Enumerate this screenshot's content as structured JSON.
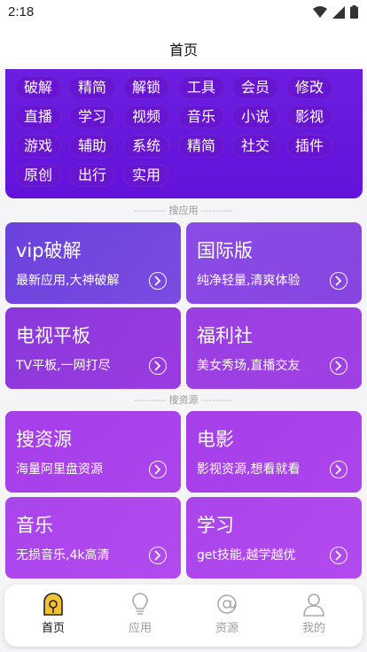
{
  "status_bar": {
    "time": "2:18",
    "icons": [
      "wifi-icon",
      "signal-icon",
      "battery-icon"
    ]
  },
  "header": {
    "title": "首页"
  },
  "tags": [
    "破解",
    "精简",
    "解锁",
    "工具",
    "会员",
    "修改",
    "直播",
    "学习",
    "视频",
    "音乐",
    "小说",
    "影视",
    "游戏",
    "辅助",
    "系统",
    "精简",
    "社交",
    "插件",
    "原创",
    "出行",
    "实用"
  ],
  "sections": {
    "apps": "搜应用",
    "resources": "搜资源"
  },
  "cards": [
    {
      "title": "vip破解",
      "subtitle": "最新应用,大神破解"
    },
    {
      "title": "国际版",
      "subtitle": "纯净轻量,清爽体验"
    },
    {
      "title": "电视平板",
      "subtitle": "TV平板,一网打尽"
    },
    {
      "title": "福利社",
      "subtitle": "美女秀场,直播交友"
    },
    {
      "title": "搜资源",
      "subtitle": "海量阿里盘资源"
    },
    {
      "title": "电影",
      "subtitle": "影视资源,想看就看"
    },
    {
      "title": "音乐",
      "subtitle": "无损音乐,4k高清"
    },
    {
      "title": "学习",
      "subtitle": "get技能,越学越优"
    }
  ],
  "nav": [
    {
      "label": "首页",
      "icon": "home-bulb-icon",
      "active": true
    },
    {
      "label": "应用",
      "icon": "lightbulb-icon",
      "active": false
    },
    {
      "label": "资源",
      "icon": "at-icon",
      "active": false
    },
    {
      "label": "我的",
      "icon": "user-icon",
      "active": false
    }
  ],
  "colors": {
    "tag_panel": "#6b1ee0",
    "accent_active": "#f2c230"
  }
}
